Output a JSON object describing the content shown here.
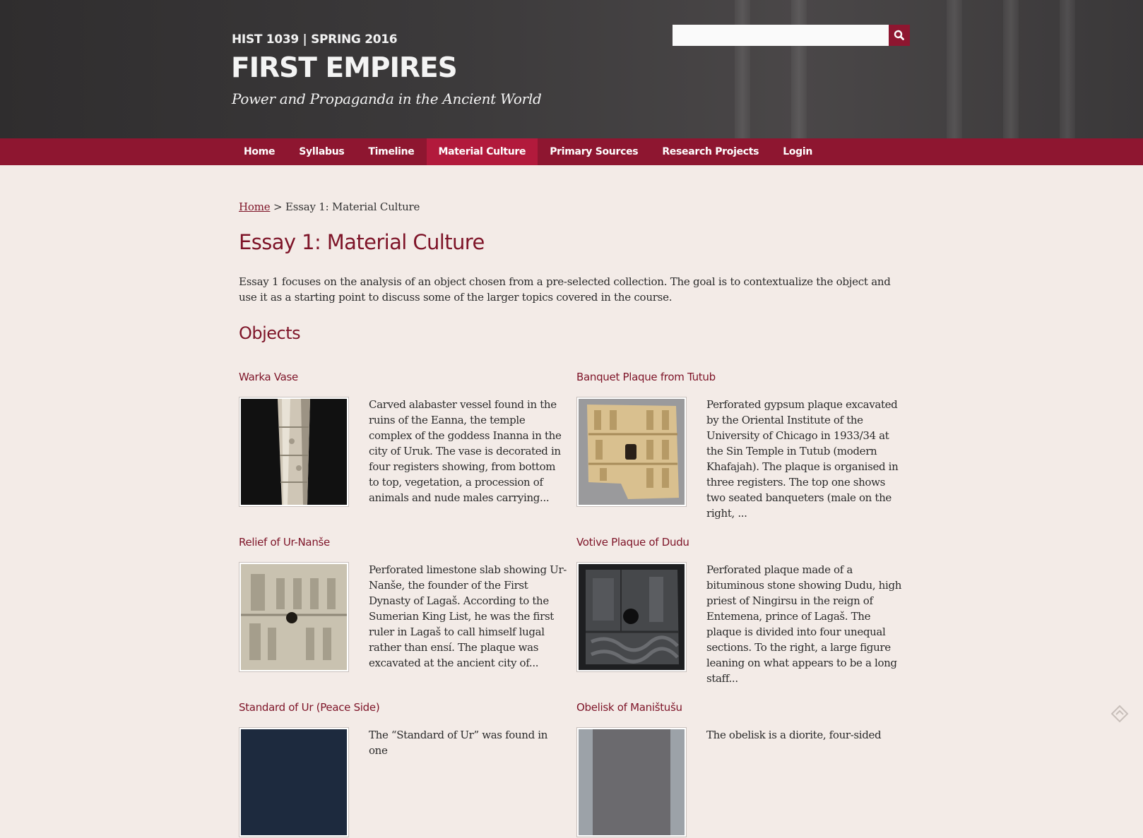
{
  "header": {
    "course_code": "HIST 1039 | SPRING 2016",
    "site_title": "FIRST EMPIRES",
    "site_subtitle": "Power and Propaganda in the Ancient World"
  },
  "search": {
    "placeholder": "",
    "button_icon": "search-icon"
  },
  "nav": {
    "items": [
      "Home",
      "Syllabus",
      "Timeline",
      "Material Culture",
      "Primary Sources",
      "Research Projects",
      "Login"
    ],
    "active": "Material Culture"
  },
  "breadcrumb": {
    "home": "Home",
    "separator": ">",
    "current": "Essay 1: Material Culture"
  },
  "page": {
    "title": "Essay 1: Material Culture",
    "intro": "Essay 1 focuses on the analysis of an object chosen from a pre-selected collection. The goal is to contextualize the object and use it as a starting point to discuss some of the larger topics covered in the course.",
    "section_title": "Objects"
  },
  "objects": [
    {
      "title": "Warka Vase",
      "text": "Carved alabaster vessel found in the ruins of the Eanna, the temple complex of the goddess Inanna in the city of Uruk. The vase is decorated in four registers showing, from bottom to top, vegetation, a procession of animals and nude males carrying..."
    },
    {
      "title": "Banquet Plaque from Tutub",
      "text": "Perforated gypsum plaque excavated by the Oriental Institute of the University of Chicago in 1933/34 at the Sin Temple in Tutub (modern Khafajah). The plaque is organised in three registers. The top one shows two seated banqueters (male on the right, ..."
    },
    {
      "title": "Relief of Ur-Nanše",
      "text": "Perforated limestone slab showing Ur-Nanše, the founder of the First Dynasty of Lagaš. According to the Sumerian King List, he was the first ruler in Lagaš to call himself lugal rather than ensí. The plaque was excavated at the ancient city of..."
    },
    {
      "title": "Votive Plaque of Dudu",
      "text": "Perforated plaque made of a bituminous stone showing Dudu, high priest of Ningirsu in the reign of Entemena, prince of Lagaš. The plaque is divided into four unequal sections. To the right, a large figure leaning on what appears to be a long staff..."
    },
    {
      "title": "Standard of Ur (Peace Side)",
      "text": "The “Standard of Ur” was found in one"
    },
    {
      "title": "Obelisk of Maništušu",
      "text": "The obelisk is a diorite, four-sided"
    }
  ],
  "colors": {
    "brand": "#8e1630",
    "active_nav": "#b21a3c",
    "heading": "#7e1428",
    "background": "#f3ebe7"
  }
}
